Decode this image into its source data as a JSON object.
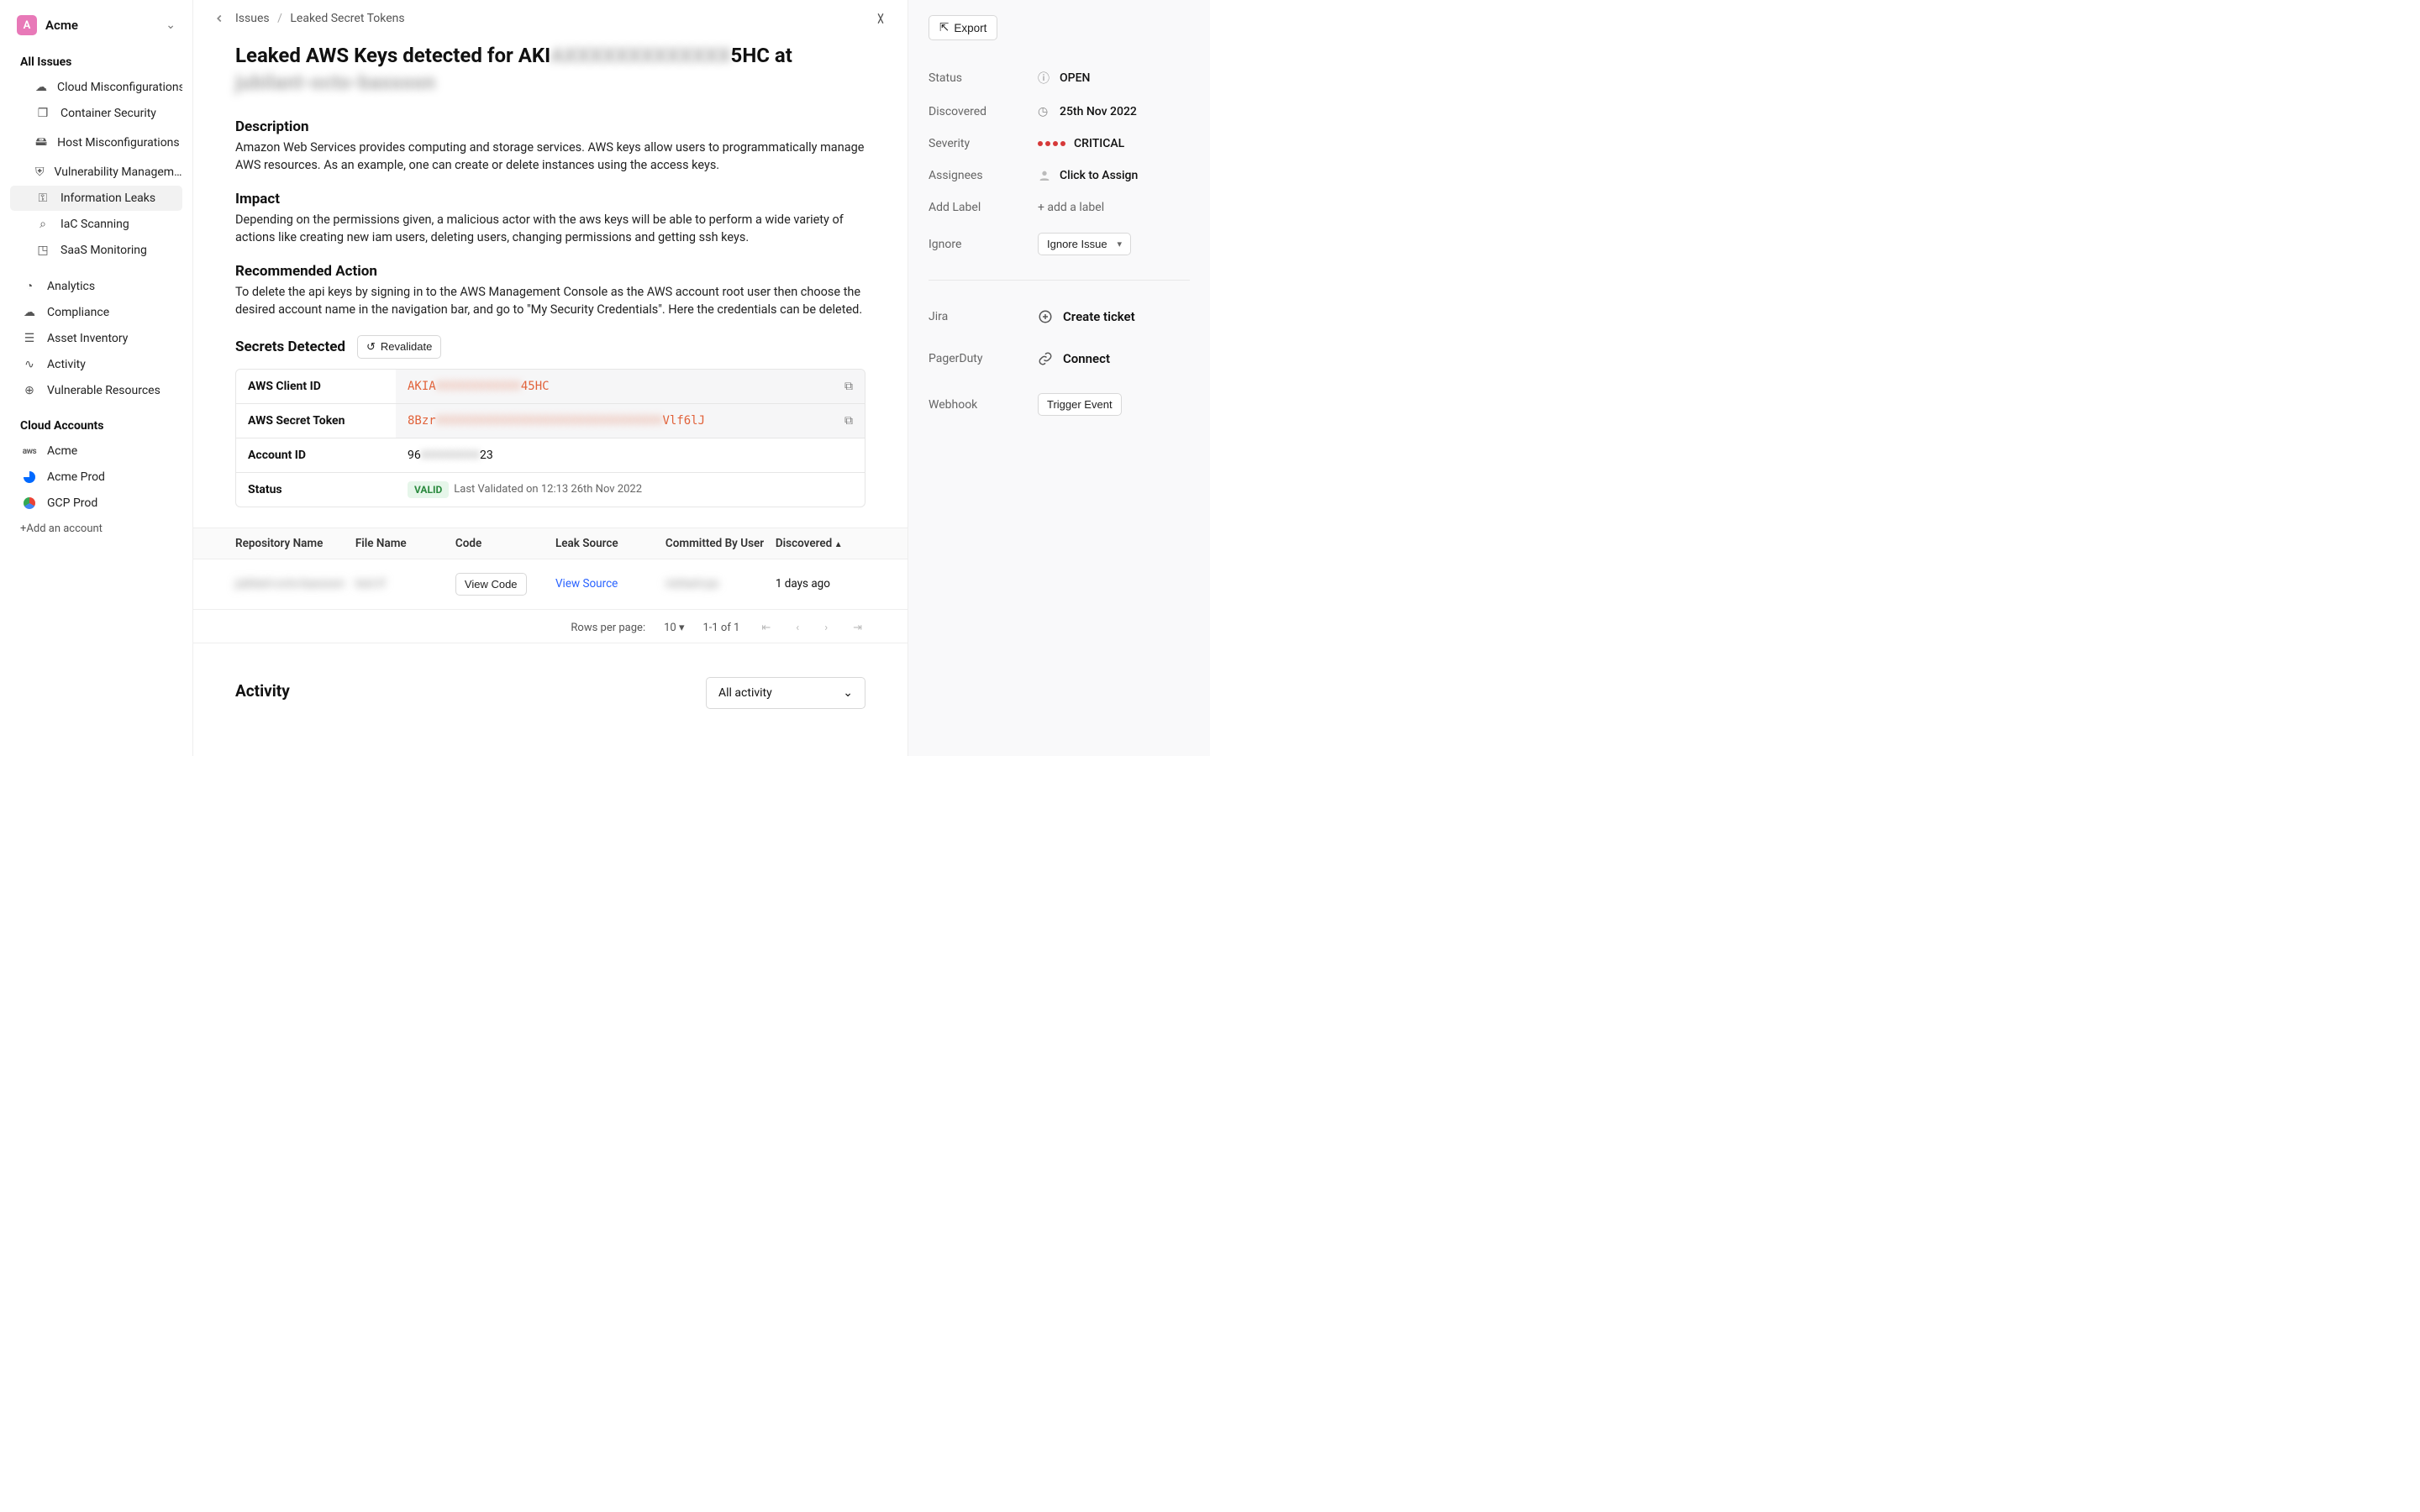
{
  "workspace": {
    "badge": "A",
    "name": "Acme"
  },
  "nav": {
    "all_issues": "All Issues",
    "items": [
      "Cloud Misconfigurations",
      "Container Security",
      "Host Misconfigurations",
      "Vulnerability Managem…",
      "Information Leaks",
      "IaC Scanning",
      "SaaS Monitoring"
    ],
    "secondary": [
      "Analytics",
      "Compliance",
      "Asset Inventory",
      "Activity",
      "Vulnerable Resources"
    ],
    "cloud_accounts_title": "Cloud Accounts",
    "accounts": [
      "Acme",
      "Acme Prod",
      "GCP Prod"
    ],
    "add_account": "+Add an account"
  },
  "breadcrumb": {
    "root": "Issues",
    "leaf": "Leaked Secret Tokens"
  },
  "issue": {
    "title_pre": "Leaked AWS Keys detected for AKI",
    "title_blur1": "AXXXXXXXXXXXXX",
    "title_mid": "5HC at ",
    "title_blur2": "jubilant-octo-bassoon",
    "description_h": "Description",
    "description": "Amazon Web Services provides computing and storage services. AWS keys allow users to programmatically manage AWS resources. As an example, one can create or delete instances using the access keys.",
    "impact_h": "Impact",
    "impact": "Depending on the permissions given, a malicious actor with the aws keys will be able to perform a wide variety of actions like creating new iam users, deleting users, changing permissions and getting ssh keys.",
    "action_h": "Recommended Action",
    "action": "To delete the api keys by signing in to the AWS Management Console as the AWS account root user then choose the desired account name in the navigation bar, and go to \"My Security Credentials\". Here the credentials can be deleted."
  },
  "secrets": {
    "title": "Secrets Detected",
    "revalidate": "Revalidate",
    "rows": {
      "client_id_k": "AWS Client ID",
      "client_id_pre": "AKIA",
      "client_id_blur": "XXXXXXXXXXXX",
      "client_id_post": "45HC",
      "secret_k": "AWS Secret Token",
      "secret_pre": "8Bzr",
      "secret_blur": "XXXXXXXXXXXXXXXXXXXXXXXXXXXXXXXX",
      "secret_post": "Vlf6lJ",
      "account_k": "Account ID",
      "account_pre": "96",
      "account_blur": "XXXXXXXX",
      "account_post": "23",
      "status_k": "Status",
      "status_badge": "VALID",
      "status_text": "Last Validated on 12:13 26th Nov 2022"
    }
  },
  "leak_table": {
    "headers": [
      "Repository Name",
      "File Name",
      "Code",
      "Leak Source",
      "Committed By User",
      "Discovered"
    ],
    "row": {
      "repo_blur": "jubilant-octo-bassoon",
      "file_blur": "test.tf",
      "view_code": "View Code",
      "view_source": "View Source",
      "user_blur": "nishant-pa",
      "discovered": "1 days ago"
    },
    "rows_per_page_label": "Rows per page:",
    "rows_per_page": "10",
    "range": "1-1 of 1"
  },
  "activity": {
    "title": "Activity",
    "filter": "All activity"
  },
  "right": {
    "export": "Export",
    "status_l": "Status",
    "status_v": "OPEN",
    "discovered_l": "Discovered",
    "discovered_v": "25th Nov 2022",
    "severity_l": "Severity",
    "severity_v": "CRITICAL",
    "assignees_l": "Assignees",
    "assignees_v": "Click to Assign",
    "label_l": "Add Label",
    "label_v": "+ add a label",
    "ignore_l": "Ignore",
    "ignore_btn": "Ignore Issue",
    "jira_l": "Jira",
    "jira_v": "Create ticket",
    "pagerduty_l": "PagerDuty",
    "pagerduty_v": "Connect",
    "webhook_l": "Webhook",
    "webhook_btn": "Trigger Event"
  }
}
